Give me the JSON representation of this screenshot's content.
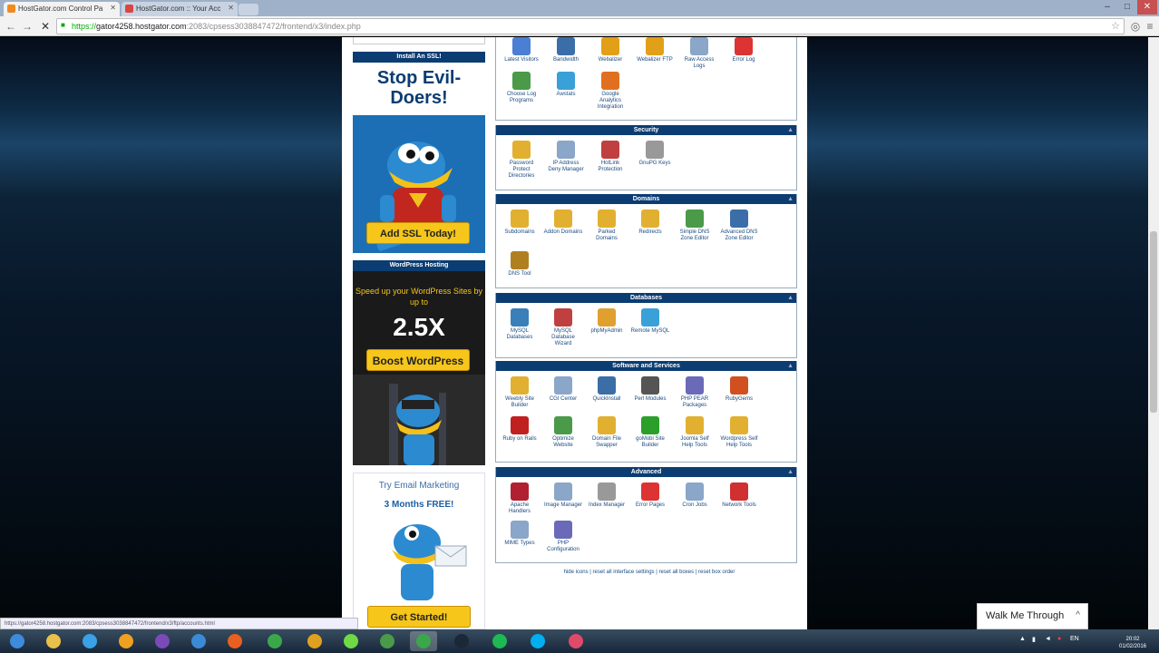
{
  "browser": {
    "tabs": [
      {
        "label": "HostGator.com Control Pa",
        "active": true,
        "icon": "hostgator-favicon"
      },
      {
        "label": "HostGator.com :: Your Acc",
        "active": false,
        "icon": "gmail-favicon"
      }
    ],
    "url": {
      "scheme": "https://",
      "host": "gator4258.hostgator.com",
      "path": ":2083/cpsess3038847472/frontend/x3/index.php"
    },
    "status_url": "https://gator4258.hostgator.com:2083/cpsess3038847472/frontend/x3/ftp/accounts.html"
  },
  "sidebar": {
    "ssl": {
      "header": "Install An SSL!",
      "headline": "Stop Evil-Doers!",
      "cta": "Add SSL Today!"
    },
    "wordpress": {
      "header": "WordPress Hosting",
      "tagline": "Speed up your WordPress Sites by up to",
      "big": "2.5X",
      "cta": "Boost WordPress"
    },
    "email": {
      "title": "Try Email Marketing",
      "subtitle": "3 Months FREE!",
      "cta": "Get Started!"
    }
  },
  "sections": [
    {
      "id": "logs",
      "title": "",
      "items": [
        {
          "label": "Latest Visitors",
          "icon": "latest-visitors-icon",
          "color": "#4a7fd4"
        },
        {
          "label": "Bandwidth",
          "icon": "bandwidth-icon",
          "color": "#3b6ea8"
        },
        {
          "label": "Webalizer",
          "icon": "webalizer-icon",
          "color": "#e2a019"
        },
        {
          "label": "Webalizer FTP",
          "icon": "webalizer-ftp-icon",
          "color": "#e2a019"
        },
        {
          "label": "Raw Access Logs",
          "icon": "raw-access-logs-icon",
          "color": "#8aa6c8"
        },
        {
          "label": "Error Log",
          "icon": "error-log-icon",
          "color": "#d33"
        },
        {
          "label": "Choose Log Programs",
          "icon": "choose-log-programs-icon",
          "color": "#4a9a4a"
        },
        {
          "label": "Awstats",
          "icon": "awstats-icon",
          "color": "#3aa0d8"
        },
        {
          "label": "Google Analytics Integration",
          "icon": "google-analytics-icon",
          "color": "#e07020"
        }
      ]
    },
    {
      "id": "security",
      "title": "Security",
      "items": [
        {
          "label": "Password Protect Directories",
          "icon": "password-protect-icon",
          "color": "#e2b030"
        },
        {
          "label": "IP Address Deny Manager",
          "icon": "ip-deny-icon",
          "color": "#8aa6c8"
        },
        {
          "label": "HotLink Protection",
          "icon": "hotlink-protection-icon",
          "color": "#c04040"
        },
        {
          "label": "GnuPG Keys",
          "icon": "gnupg-keys-icon",
          "color": "#999"
        }
      ]
    },
    {
      "id": "domains",
      "title": "Domains",
      "items": [
        {
          "label": "Subdomains",
          "icon": "subdomains-icon",
          "color": "#e2b030"
        },
        {
          "label": "Addon Domains",
          "icon": "addon-domains-icon",
          "color": "#e2b030"
        },
        {
          "label": "Parked Domains",
          "icon": "parked-domains-icon",
          "color": "#e2b030"
        },
        {
          "label": "Redirects",
          "icon": "redirects-icon",
          "color": "#e2b030"
        },
        {
          "label": "Simple DNS Zone Editor",
          "icon": "simple-dns-icon",
          "color": "#4a9a4a"
        },
        {
          "label": "Advanced DNS Zone Editor",
          "icon": "advanced-dns-icon",
          "color": "#3b6ea8"
        },
        {
          "label": "DNS Tool",
          "icon": "dns-tool-icon",
          "color": "#b08020"
        }
      ]
    },
    {
      "id": "databases",
      "title": "Databases",
      "items": [
        {
          "label": "MySQL Databases",
          "icon": "mysql-databases-icon",
          "color": "#3a7fb8"
        },
        {
          "label": "MySQL Database Wizard",
          "icon": "mysql-wizard-icon",
          "color": "#c04040"
        },
        {
          "label": "phpMyAdmin",
          "icon": "phpmyadmin-icon",
          "color": "#e0a030"
        },
        {
          "label": "Remote MySQL",
          "icon": "remote-mysql-icon",
          "color": "#3aa0d8"
        }
      ]
    },
    {
      "id": "software",
      "title": "Software and Services",
      "items": [
        {
          "label": "Weebly Site Builder",
          "icon": "weebly-icon",
          "color": "#e2b030"
        },
        {
          "label": "CGI Center",
          "icon": "cgi-center-icon",
          "color": "#8aa6c8"
        },
        {
          "label": "QuickInstall",
          "icon": "quickinstall-icon",
          "color": "#3a6ea5"
        },
        {
          "label": "Perl Modules",
          "icon": "perl-modules-icon",
          "color": "#555"
        },
        {
          "label": "PHP PEAR Packages",
          "icon": "php-pear-icon",
          "color": "#6a6ab8"
        },
        {
          "label": "RubyGems",
          "icon": "rubygems-icon",
          "color": "#d05020"
        },
        {
          "label": "Ruby on Rails",
          "icon": "ruby-on-rails-icon",
          "color": "#c02020"
        },
        {
          "label": "Optimize Website",
          "icon": "optimize-website-icon",
          "color": "#4a9a4a"
        },
        {
          "label": "Domain File Swapper",
          "icon": "domain-file-swapper-icon",
          "color": "#e2b030"
        },
        {
          "label": "goMobi Site Builder",
          "icon": "gomobi-icon",
          "color": "#2aa02a"
        },
        {
          "label": "Joomla Self Help Tools",
          "icon": "joomla-help-icon",
          "color": "#e2b030"
        },
        {
          "label": "Wordpress Self Help Tools",
          "icon": "wordpress-help-icon",
          "color": "#e2b030"
        }
      ]
    },
    {
      "id": "advanced",
      "title": "Advanced",
      "items": [
        {
          "label": "Apache Handlers",
          "icon": "apache-handlers-icon",
          "color": "#b02030"
        },
        {
          "label": "Image Manager",
          "icon": "image-manager-icon",
          "color": "#8aa6c8"
        },
        {
          "label": "Index Manager",
          "icon": "index-manager-icon",
          "color": "#999"
        },
        {
          "label": "Error Pages",
          "icon": "error-pages-icon",
          "color": "#d33"
        },
        {
          "label": "Cron Jobs",
          "icon": "cron-jobs-icon",
          "color": "#8aa6c8"
        },
        {
          "label": "Network Tools",
          "icon": "network-tools-icon",
          "color": "#d03030"
        },
        {
          "label": "MIME Types",
          "icon": "mime-types-icon",
          "color": "#8aa6c8"
        },
        {
          "label": "PHP Configuration",
          "icon": "php-configuration-icon",
          "color": "#6a6ab8"
        }
      ]
    }
  ],
  "footer_links": "hide icons | reset all interface settings | reset all boxes | reset box order",
  "walkme": {
    "label": "Walk Me Through"
  },
  "taskbar": {
    "apps": [
      {
        "icon": "start-icon",
        "color": "#3c8bdc"
      },
      {
        "icon": "file-explorer-icon",
        "color": "#e8c04a"
      },
      {
        "icon": "internet-explorer-icon",
        "color": "#3aa0e8"
      },
      {
        "icon": "hostgator-app-icon",
        "color": "#f0a020"
      },
      {
        "icon": "viber-icon",
        "color": "#7a4ab8"
      },
      {
        "icon": "messenger-icon",
        "color": "#3a8ad8"
      },
      {
        "icon": "firefox-icon",
        "color": "#e86020"
      },
      {
        "icon": "chrome-icon",
        "color": "#3aa84a"
      },
      {
        "icon": "media-app-icon",
        "color": "#e0a020"
      },
      {
        "icon": "upwork-icon",
        "color": "#6fda44"
      },
      {
        "icon": "utorrent-icon",
        "color": "#4a9a4a"
      },
      {
        "icon": "chrome-active-icon",
        "color": "#3aa84a",
        "active": true
      },
      {
        "icon": "steam-icon",
        "color": "#1b2838"
      },
      {
        "icon": "spotify-icon",
        "color": "#1db954"
      },
      {
        "icon": "skype-icon",
        "color": "#00aff0"
      },
      {
        "icon": "itunes-icon",
        "color": "#e04a6a"
      }
    ],
    "time": "20:02",
    "date": "01/02/2016"
  }
}
